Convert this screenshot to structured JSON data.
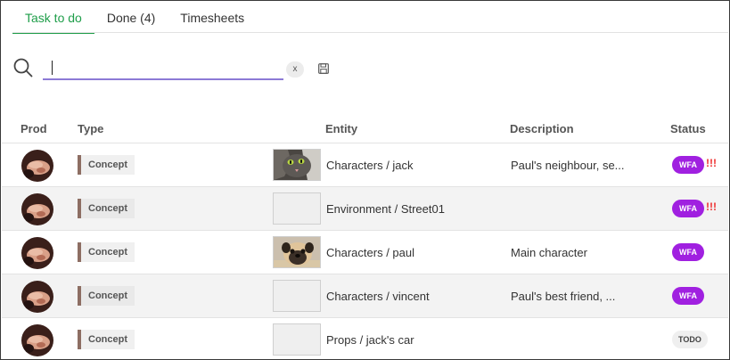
{
  "tabs": [
    {
      "label": "Task to do",
      "active": true
    },
    {
      "label": "Done (4)",
      "active": false
    },
    {
      "label": "Timesheets",
      "active": false
    }
  ],
  "search": {
    "placeholder": "",
    "value": "",
    "clear_label": "x"
  },
  "columns": {
    "prod": "Prod",
    "type": "Type",
    "entity": "Entity",
    "description": "Description",
    "status": "Status"
  },
  "colors": {
    "accent": "#1f9e4a",
    "wfa": "#a020e0",
    "priority": "#e33333",
    "type_bar": "#8d6e63"
  },
  "rows": [
    {
      "type": "Concept",
      "entity": "Characters / jack",
      "description": "Paul's neighbour, se...",
      "status": "WFA",
      "priority": "!!!",
      "thumb": "cat"
    },
    {
      "type": "Concept",
      "entity": "Environment / Street01",
      "description": "",
      "status": "WFA",
      "priority": "!!!",
      "thumb": "empty"
    },
    {
      "type": "Concept",
      "entity": "Characters / paul",
      "description": "Main character",
      "status": "WFA",
      "priority": "",
      "thumb": "pug"
    },
    {
      "type": "Concept",
      "entity": "Characters / vincent",
      "description": "Paul's best friend, ...",
      "status": "WFA",
      "priority": "",
      "thumb": "empty"
    },
    {
      "type": "Concept",
      "entity": "Props / jack's car",
      "description": "",
      "status": "TODO",
      "priority": "",
      "thumb": "empty"
    }
  ]
}
